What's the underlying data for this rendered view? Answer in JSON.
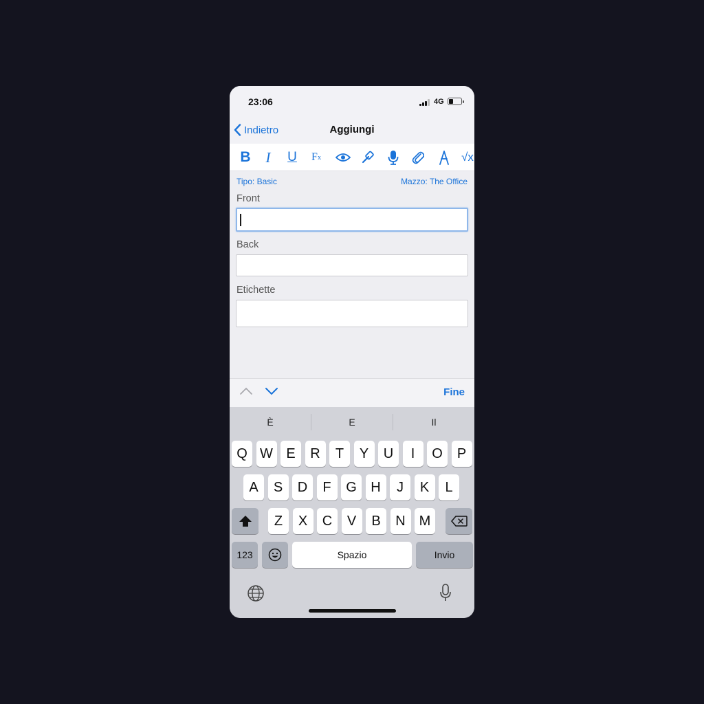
{
  "status": {
    "time": "23:06",
    "network": "4G",
    "battery_level": 0.35
  },
  "nav": {
    "back_label": "Indietro",
    "title": "Aggiungi"
  },
  "toolbar": {
    "bold": "B",
    "italic": "I",
    "underline": "U",
    "fx": "F",
    "fx_sub": "x",
    "sqrt": "√x"
  },
  "meta": {
    "type_label": "Tipo: Basic",
    "deck_label": "Mazzo: The Office"
  },
  "fields": [
    {
      "label": "Front",
      "value": ""
    },
    {
      "label": "Back",
      "value": ""
    },
    {
      "label": "Etichette",
      "value": ""
    }
  ],
  "accessory": {
    "done_label": "Fine"
  },
  "keyboard": {
    "suggestions": [
      "È",
      "E",
      "Il"
    ],
    "row1": [
      "Q",
      "W",
      "E",
      "R",
      "T",
      "Y",
      "U",
      "I",
      "O",
      "P"
    ],
    "row2": [
      "A",
      "S",
      "D",
      "F",
      "G",
      "H",
      "J",
      "K",
      "L"
    ],
    "row3": [
      "Z",
      "X",
      "C",
      "V",
      "B",
      "N",
      "M"
    ],
    "numbers_label": "123",
    "space_label": "Spazio",
    "return_label": "Invio"
  },
  "colors": {
    "accent": "#1a73d9",
    "background": "#14141f"
  }
}
